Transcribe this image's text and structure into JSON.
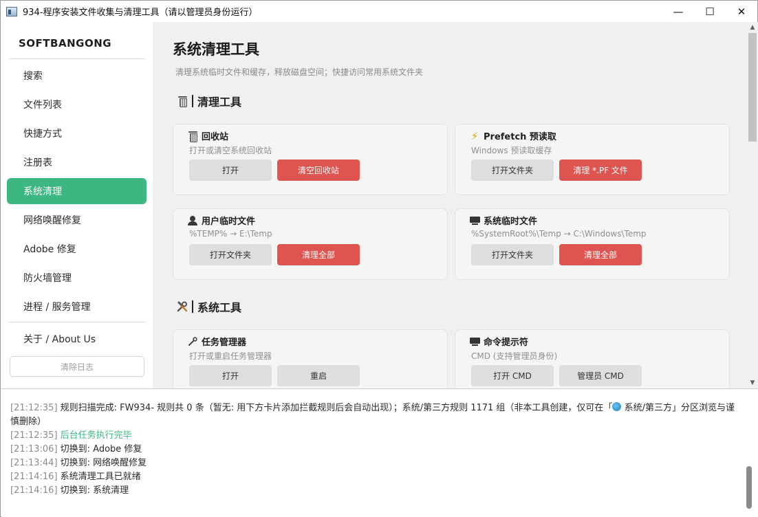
{
  "window": {
    "title": "934-程序安装文件收集与清理工具（请以管理员身份运行）",
    "controls": {
      "minimize": "—",
      "maximize": "☐",
      "close": "✕"
    }
  },
  "sidebar": {
    "brand": "SOFTBANGONG",
    "items": [
      {
        "label": "搜索",
        "active": false
      },
      {
        "label": "文件列表",
        "active": false
      },
      {
        "label": "快捷方式",
        "active": false
      },
      {
        "label": "注册表",
        "active": false
      },
      {
        "label": "系统清理",
        "active": true
      },
      {
        "label": "网络唤醒修复",
        "active": false
      },
      {
        "label": "Adobe 修复",
        "active": false
      },
      {
        "label": "防火墙管理",
        "active": false
      },
      {
        "label": "进程 / 服务管理",
        "active": false
      }
    ],
    "about": "关于 / About Us",
    "clear_log": "清除日志"
  },
  "main": {
    "title": "系统清理工具",
    "subtitle": "清理系统临时文件和缓存，释放磁盘空间；快捷访问常用系统文件夹",
    "sections": [
      {
        "icon": "trash-icon",
        "label": "清理工具"
      },
      {
        "icon": "tools-icon",
        "label": "系统工具"
      }
    ],
    "cards": {
      "recycle": {
        "icon": "trash-icon",
        "title": "回收站",
        "desc": "打开或清空系统回收站",
        "btn1": "打开",
        "btn2": "清空回收站"
      },
      "prefetch": {
        "icon": "lightning-icon",
        "title": "Prefetch 预读取",
        "desc": "Windows 预读取缓存",
        "btn1": "打开文件夹",
        "btn2": "清理 *.PF 文件"
      },
      "user_temp": {
        "icon": "user-icon",
        "title": "用户临时文件",
        "desc": "%TEMP% → E:\\Temp",
        "btn1": "打开文件夹",
        "btn2": "清理全部"
      },
      "sys_temp": {
        "icon": "monitor-icon",
        "title": "系统临时文件",
        "desc": "%SystemRoot%\\Temp → C:\\Windows\\Temp",
        "btn1": "打开文件夹",
        "btn2": "清理全部"
      },
      "taskmgr": {
        "icon": "wrench-icon",
        "title": "任务管理器",
        "desc": "打开或重启任务管理器",
        "btn1": "打开",
        "btn2": "重启"
      },
      "cmd": {
        "icon": "monitor-icon",
        "title": "命令提示符",
        "desc": "CMD (支持管理员身份)",
        "btn1": "打开 CMD",
        "btn2": "管理员 CMD"
      }
    }
  },
  "log": {
    "lines": [
      {
        "time": "[21:12:35]",
        "text": "规则扫描完成: FW934- 规则共 0 条（暂无: 用下方卡片添加拦截规则后会自动出现）；系统/第三方规则 1171 组（非本工具创建，仅可在「",
        "text2": " 系统/第三方」分区浏览与谨慎删除）",
        "style": "normal"
      },
      {
        "time": "[21:12:35]",
        "text": "后台任务执行完毕",
        "style": "green"
      },
      {
        "time": "[21:13:06]",
        "text": "切换到: Adobe 修复",
        "style": "normal"
      },
      {
        "time": "[21:13:44]",
        "text": "切换到: 网络唤醒修复",
        "style": "normal"
      },
      {
        "time": "[21:14:16]",
        "text": "系统清理工具已就绪",
        "style": "normal"
      },
      {
        "time": "[21:14:16]",
        "text": "切换到: 系统清理",
        "style": "normal"
      }
    ]
  },
  "colors": {
    "accent": "#3db682",
    "danger": "#dd5450",
    "panel": "#f0f0f0"
  }
}
